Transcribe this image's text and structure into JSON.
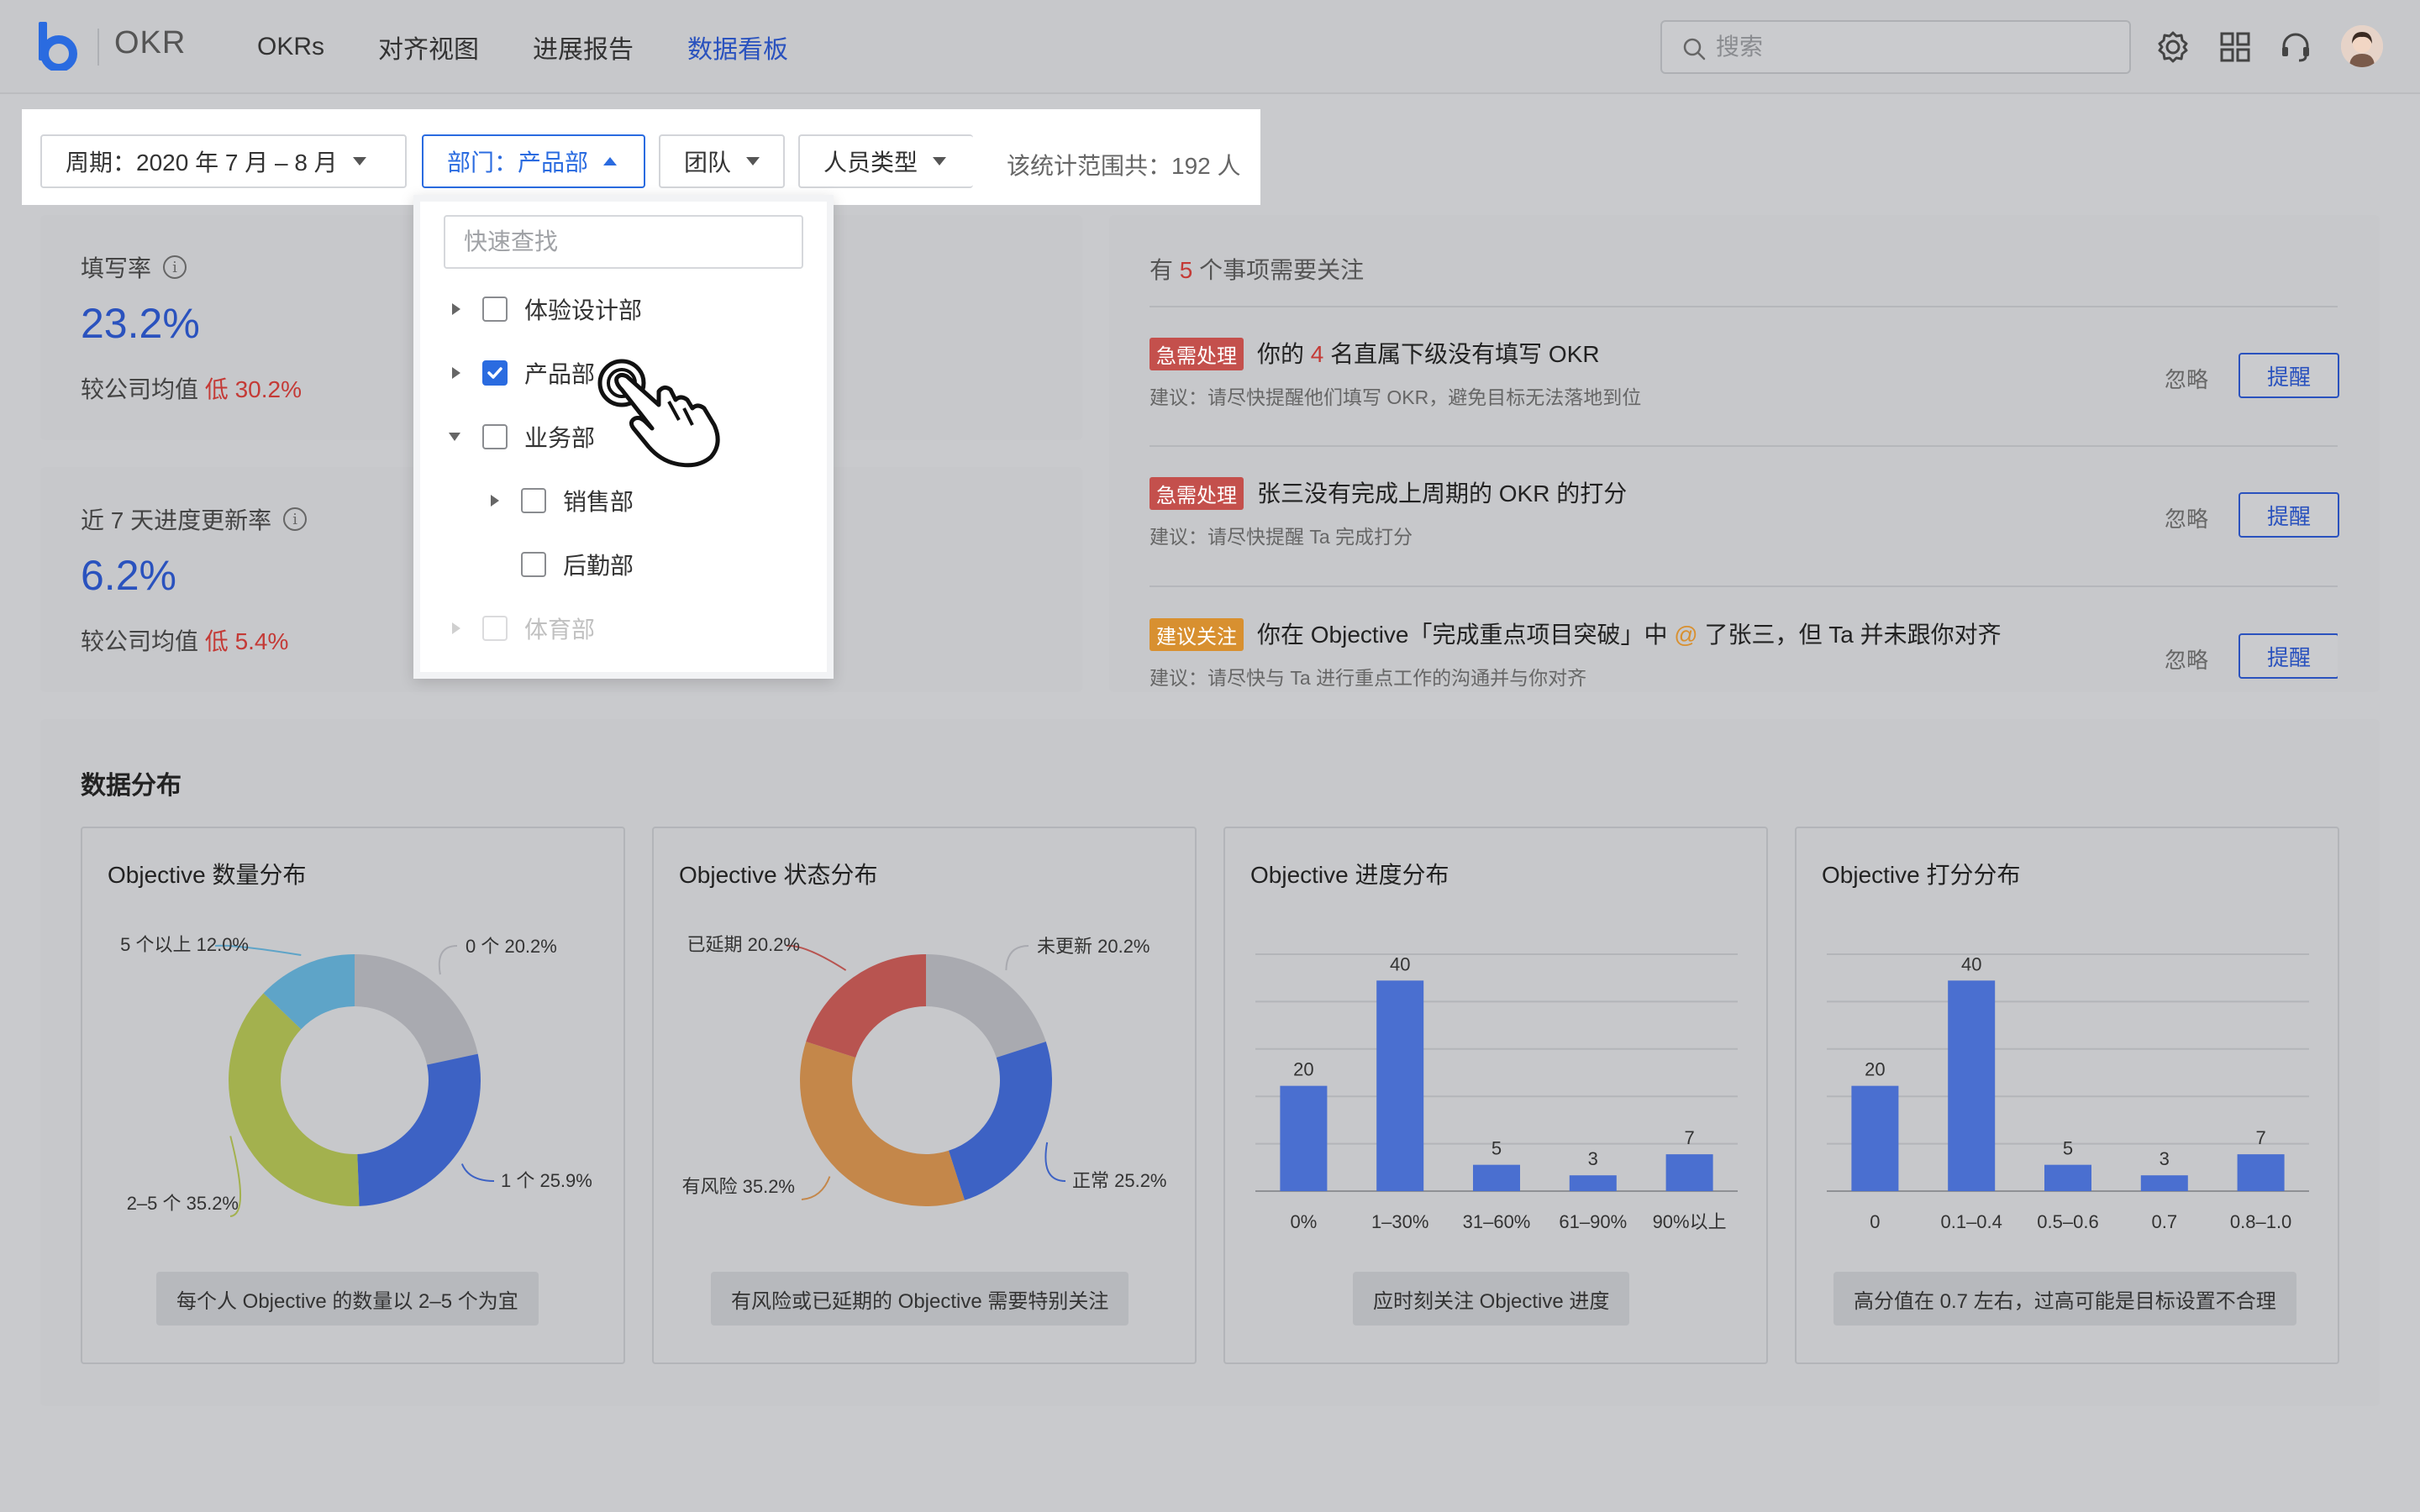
{
  "header": {
    "app_title": "OKR",
    "nav": [
      "OKRs",
      "对齐视图",
      "进展报告",
      "数据看板"
    ],
    "active_nav": 3,
    "search_placeholder": "搜索"
  },
  "filters": {
    "period": "周期：2020 年 7 月 – 8 月",
    "department": "部门：产品部",
    "team": "团队",
    "person_type": "人员类型",
    "scope": "该统计范围共：192 人"
  },
  "dropdown": {
    "search_placeholder": "快速查找",
    "items": [
      {
        "label": "体验设计部",
        "checked": false,
        "arrow": "right"
      },
      {
        "label": "产品部",
        "checked": true,
        "arrow": "right"
      },
      {
        "label": "业务部",
        "checked": false,
        "arrow": "down"
      },
      {
        "label": "销售部",
        "checked": false,
        "arrow": "right"
      },
      {
        "label": "后勤部",
        "checked": false,
        "arrow": "none"
      },
      {
        "label": "体育部",
        "checked": false,
        "arrow": "right"
      }
    ]
  },
  "stats": {
    "fill_rate": {
      "label": "填写率",
      "value": "23.2%",
      "compare_prefix": "较公司均值",
      "compare_low": "低 30.2%"
    },
    "update_rate": {
      "label": "近 7 天进度更新率",
      "value": "6.2%",
      "compare_prefix": "较公司均值",
      "compare_low": "低 5.4%"
    }
  },
  "alerts": {
    "head_prefix": "有",
    "count": "5",
    "head_suffix": "个事项需要关注",
    "ignore_label": "忽略",
    "remind_label": "提醒",
    "items": [
      {
        "tag": "急需处理",
        "title_a": "你的",
        "title_hl": "4",
        "title_b": "名直属下级没有填写 OKR",
        "sub": "建议：请尽快提醒他们填写 OKR，避免目标无法落地到位"
      },
      {
        "tag": "急需处理",
        "title_a": "张三没有完成上周期的 OKR 的打分",
        "title_hl": "",
        "title_b": "",
        "sub": "建议：请尽快提醒 Ta 完成打分"
      },
      {
        "tag": "建议关注",
        "title_a": "你在 Objective「完成重点项目突破」中",
        "title_hl": "@",
        "title_b": "了张三，但 Ta 并未跟你对齐",
        "sub": "建议：请尽快与 Ta 进行重点工作的沟通并与你对齐"
      }
    ]
  },
  "distribution": {
    "title": "数据分布",
    "panels": [
      {
        "title": "Objective 数量分布",
        "note": "每个人 Objective 的数量以 2–5 个为宜"
      },
      {
        "title": "Objective 状态分布",
        "note": "有风险或已延期的 Objective 需要特别关注"
      },
      {
        "title": "Objective 进度分布",
        "note": "应时刻关注 Objective 进度"
      },
      {
        "title": "Objective 打分分布",
        "note": "高分值在 0.7 左右，过高可能是目标设置不合理"
      }
    ]
  },
  "chart_data": [
    {
      "type": "pie",
      "title": "Objective 数量分布",
      "slices": [
        {
          "label": "0 个",
          "value": 20.2,
          "text": "20.2%",
          "color": "#a9aab0"
        },
        {
          "label": "1 个",
          "value": 25.9,
          "text": "25.9%",
          "color": "#3d62c4"
        },
        {
          "label": "2–5 个",
          "value": 35.2,
          "text": "35.2%",
          "color": "#a3b14e"
        },
        {
          "label": "5 个以上",
          "value": 12.0,
          "text": "12.0%",
          "color": "#5ea4c8"
        }
      ]
    },
    {
      "type": "pie",
      "title": "Objective 状态分布",
      "slices": [
        {
          "label": "未更新",
          "value": 20.2,
          "text": "20.2%",
          "color": "#a9aab0"
        },
        {
          "label": "正常",
          "value": 25.2,
          "text": "25.2%",
          "color": "#3d62c4"
        },
        {
          "label": "有风险",
          "value": 35.2,
          "text": "35.2%",
          "color": "#c4874a"
        },
        {
          "label": "已延期",
          "value": 20.2,
          "text": "20.2%",
          "color": "#b85450"
        }
      ]
    },
    {
      "type": "bar",
      "title": "Objective 进度分布",
      "categories": [
        "0%",
        "1–30%",
        "31–60%",
        "61–90%",
        "90%以上"
      ],
      "values": [
        20,
        40,
        5,
        3,
        7
      ],
      "ylim": [
        0,
        45
      ],
      "color": "#4a6fd0"
    },
    {
      "type": "bar",
      "title": "Objective 打分分布",
      "categories": [
        "0",
        "0.1–0.4",
        "0.5–0.6",
        "0.7",
        "0.8–1.0"
      ],
      "values": [
        20,
        40,
        5,
        3,
        7
      ],
      "ylim": [
        0,
        45
      ],
      "color": "#4a6fd0"
    }
  ]
}
